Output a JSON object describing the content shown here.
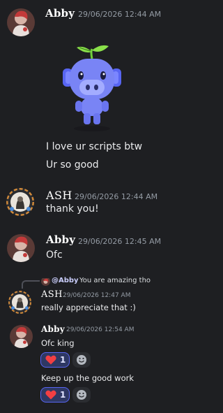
{
  "messages": [
    {
      "author": "Abby",
      "timestamp": "29/06/2026 12:44 AM",
      "lines": [
        "I love ur scripts btw",
        "Ur so good"
      ]
    },
    {
      "author": "ASH",
      "timestamp": "29/06/2026 12:44 AM",
      "lines": [
        "thank you!"
      ]
    },
    {
      "author": "Abby",
      "timestamp": "29/06/2026 12:45 AM",
      "lines": [
        "Ofc"
      ]
    },
    {
      "reply": {
        "mention": "@Abby",
        "quoted": "You are amazing tho"
      },
      "author": "ASH",
      "timestamp": "29/06/2026 12:47 AM",
      "lines": [
        "really appreciate that :)"
      ]
    },
    {
      "author": "Abby",
      "timestamp": "29/06/2026 12:54 AM",
      "lines": [
        "Ofc king",
        "Keep up the good work"
      ]
    }
  ],
  "reactions": [
    {
      "emoji": "heart",
      "count": "1"
    },
    {
      "emoji": "heart",
      "count": "1"
    }
  ],
  "sticker": {
    "name": "wumpus-sprout-sticker"
  },
  "colors": {
    "background": "#1e1f22",
    "reaction_bg": "#2e3863",
    "reaction_border": "#5865f2",
    "timestamp": "#949ba4",
    "heart": "#f23f43"
  }
}
